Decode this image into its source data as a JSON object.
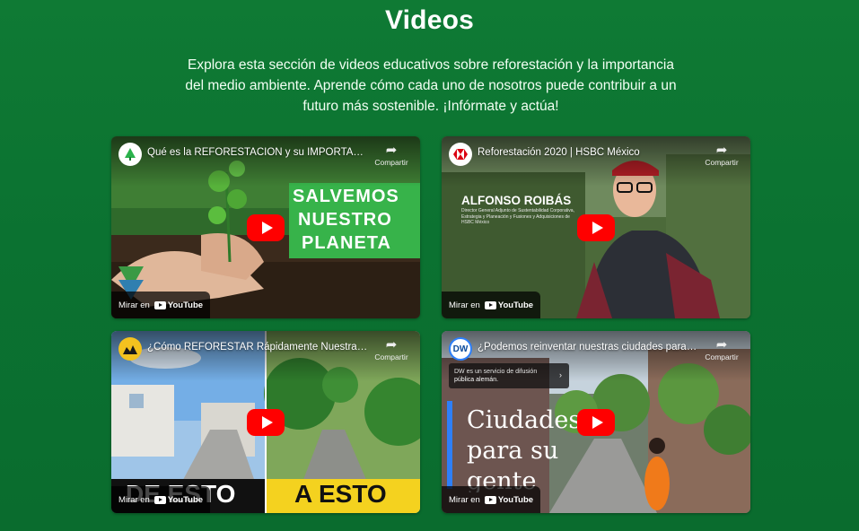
{
  "page": {
    "title": "Videos",
    "intro": "Explora esta sección de videos educativos sobre reforestación y la importancia del medio ambiente. Aprende cómo cada uno de nosotros puede contribuir a un futuro más sostenible. ¡Infórmate y actúa!"
  },
  "common": {
    "share_label": "Compartir",
    "watch_on": "Mirar en",
    "youtube": "YouTube"
  },
  "videos": [
    {
      "title": "Qué es la REFORESTACIÓN y su IMPORTANCIA ...",
      "overlay": [
        "SALVEMOS",
        "NUESTRO",
        "PLANETA"
      ],
      "channel_icon": "leaf-icon"
    },
    {
      "title": "Reforestación 2020 | HSBC México",
      "overlay_name": "ALFONSO ROIBÁS",
      "overlay_role": "Director General Adjunto de Sustentabilidad Corporativa, Estrategia y Planeación y Fusiones y Adquisiciones de HSBC México",
      "channel_icon": "hsbc-icon"
    },
    {
      "title": "¿Cómo REFORESTAR Rápidamente Nuestras Ci...",
      "overlay_left": "DE ESTO",
      "overlay_right": "A ESTO",
      "channel_icon": "channel-avatar-icon"
    },
    {
      "title": "¿Podemos reinventar nuestras ciudades para vi...",
      "dw_badge": "DW",
      "info": "DW es un servicio de difusión pública alemán.",
      "overlay": [
        "Ciudades",
        "para su",
        "gente"
      ],
      "channel_icon": "dw-icon"
    }
  ]
}
